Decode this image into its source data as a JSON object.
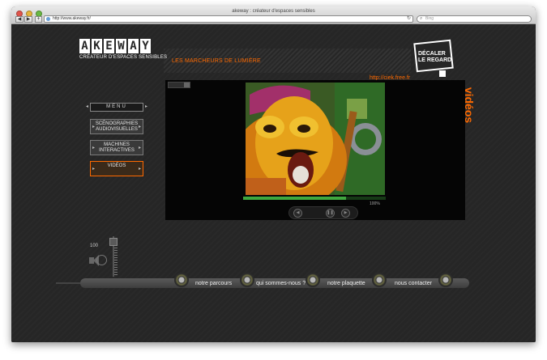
{
  "browser": {
    "window_title": "akeway : créateur d'espaces sensibles",
    "url": "http://www.akeway.fr/",
    "search_placeholder": "Bing",
    "back_glyph": "◀",
    "forward_glyph": "▶",
    "add_glyph": "+",
    "reload_glyph": "↻",
    "search_glyph": "⌕"
  },
  "logo": {
    "letters": [
      "A",
      "K",
      "E",
      "W",
      "A",
      "Y"
    ],
    "subtitle": "CRÉATEUR D'ESPACES SENSIBLES"
  },
  "header": {
    "heading": "LES MARCHEURS DE LUMIÈRE",
    "link_text": "http://ciek.free.fr",
    "decaler_line1": "DÉCALER",
    "decaler_line2": "LE REGARD",
    "section_label": "vidéos"
  },
  "menu": {
    "title": "MENU",
    "arrow_left": "◂",
    "arrow_right": "▸",
    "items": [
      {
        "line1": "SCÉNOGRAPHIES",
        "line2": "AUDIOVISUELLES",
        "active": false
      },
      {
        "line1": "MACHINES",
        "line2": "INTERACTIVES",
        "active": false
      },
      {
        "line1": "VIDÉOS",
        "line2": "",
        "active": true
      }
    ]
  },
  "video": {
    "progress_fraction": 0.72,
    "progress_label": "100%",
    "controls": {
      "prev": "◀",
      "pause": "❚❚",
      "next": "▶"
    }
  },
  "volume": {
    "value_label": "100",
    "level": 1.0
  },
  "bottom_nav": [
    {
      "label": "notre parcours"
    },
    {
      "label": "qui sommes-nous ?"
    },
    {
      "label": "notre plaquette"
    },
    {
      "label": "nous contacter"
    }
  ],
  "colors": {
    "accent": "#ff6a00",
    "background": "#262626",
    "progress": "#3fa83f"
  }
}
